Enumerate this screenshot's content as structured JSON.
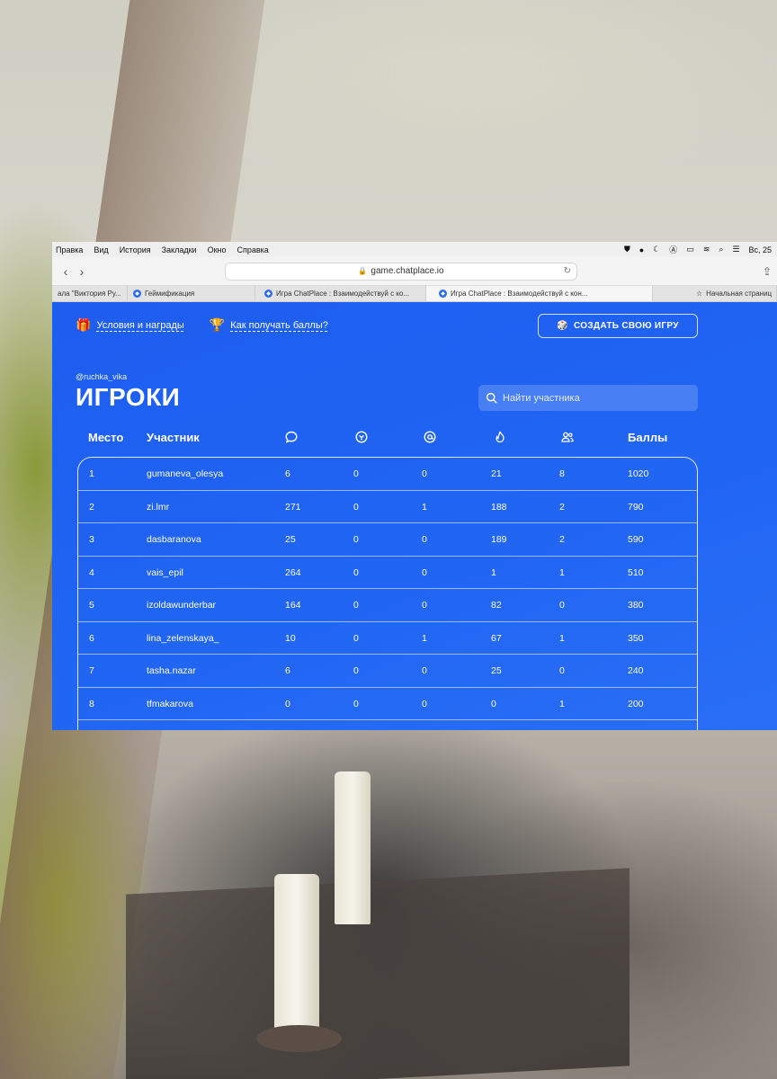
{
  "menubar": {
    "items": [
      "Правка",
      "Вид",
      "История",
      "Закладки",
      "Окно",
      "Справка"
    ],
    "clock": "Вс, 25"
  },
  "browser": {
    "url": "game.chatplace.io",
    "tabs": [
      {
        "label": "ала \"Виктория Ру..."
      },
      {
        "label": "Геймификация"
      },
      {
        "label": "Игра ChatPlace : Взаимодействуй с ко..."
      },
      {
        "label": "Игра ChatPlace : Взаимодействуй с кон..."
      },
      {
        "label": "Начальная страниц"
      }
    ]
  },
  "header": {
    "rules_link": "Условия и награды",
    "points_link": "Как получать баллы?",
    "create_button": "СОЗДАТЬ СВОЮ ИГРУ"
  },
  "page": {
    "handle": "@ruchka_vika",
    "title": "ИГРОКИ",
    "search_placeholder": "Найти участника"
  },
  "table": {
    "col_place": "Место",
    "col_player": "Участник",
    "col_points": "Баллы",
    "icons": [
      "comment-icon",
      "broadcast-icon",
      "mention-icon",
      "fire-icon",
      "referral-icon"
    ],
    "rows": [
      {
        "place": "1",
        "name": "gumaneva_olesya",
        "comments": "6",
        "col2": "0",
        "col3": "0",
        "col4": "21",
        "col5": "8",
        "points": "1020"
      },
      {
        "place": "2",
        "name": "zi.lmr",
        "comments": "271",
        "col2": "0",
        "col3": "1",
        "col4": "188",
        "col5": "2",
        "points": "790"
      },
      {
        "place": "3",
        "name": "dasbaranova",
        "comments": "25",
        "col2": "0",
        "col3": "0",
        "col4": "189",
        "col5": "2",
        "points": "590"
      },
      {
        "place": "4",
        "name": "vais_epil",
        "comments": "264",
        "col2": "0",
        "col3": "0",
        "col4": "1",
        "col5": "1",
        "points": "510"
      },
      {
        "place": "5",
        "name": "izoldawunderbar",
        "comments": "164",
        "col2": "0",
        "col3": "0",
        "col4": "82",
        "col5": "0",
        "points": "380"
      },
      {
        "place": "6",
        "name": "lina_zelenskaya_",
        "comments": "10",
        "col2": "0",
        "col3": "1",
        "col4": "67",
        "col5": "1",
        "points": "350"
      },
      {
        "place": "7",
        "name": "tasha.nazar",
        "comments": "6",
        "col2": "0",
        "col3": "0",
        "col4": "25",
        "col5": "0",
        "points": "240"
      },
      {
        "place": "8",
        "name": "tfmakarova",
        "comments": "0",
        "col2": "0",
        "col3": "0",
        "col4": "0",
        "col5": "1",
        "points": "200"
      }
    ]
  },
  "colors": {
    "accent": "#1f5ff0"
  }
}
